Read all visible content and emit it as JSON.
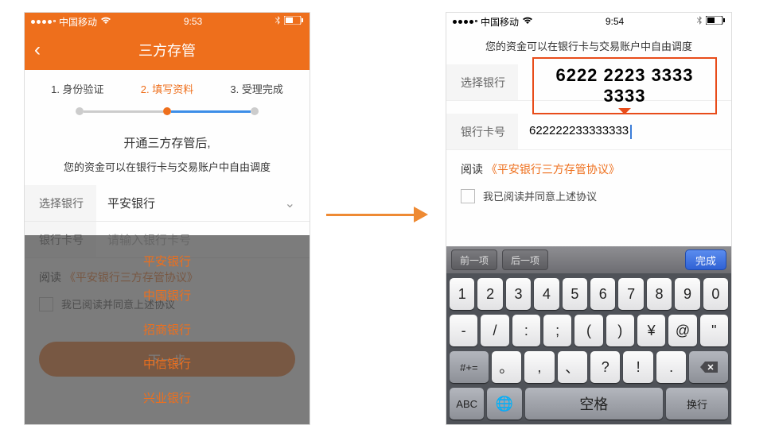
{
  "left": {
    "status": {
      "carrier": "中国移动",
      "time": "9:53"
    },
    "header": {
      "title": "三方存管"
    },
    "steps": {
      "s1": "1. 身份验证",
      "s2": "2. 填写资料",
      "s3": "3. 受理完成"
    },
    "info1": "开通三方存管后,",
    "info2": "您的资金可以在银行卡与交易账户中自由调度",
    "bank": {
      "label": "选择银行",
      "value": "平安银行"
    },
    "card": {
      "label": "银行卡号",
      "placeholder": "请输入银行卡号"
    },
    "readPrefix": "阅读",
    "agreementLink": "《平安银行三方存管协议》",
    "agreeText": "我已阅读并同意上述协议",
    "nextBtn": "下一步",
    "dropdown": [
      "平安银行",
      "中国银行",
      "招商银行",
      "中信银行",
      "兴业银行"
    ]
  },
  "right": {
    "status": {
      "carrier": "中国移动",
      "time": "9:54"
    },
    "info2": "您的资金可以在银行卡与交易账户中自由调度",
    "bank": {
      "label": "选择银行",
      "formatted": "6222 2223 3333 3333"
    },
    "card": {
      "label": "银行卡号",
      "value": "622222233333333"
    },
    "readPrefix": "阅读",
    "agreementLink": "《平安银行三方存管协议》",
    "agreeText": "我已阅读并同意上述协议",
    "kb": {
      "prev": "前一项",
      "next": "后一项",
      "done": "完成",
      "r1": [
        "1",
        "2",
        "3",
        "4",
        "5",
        "6",
        "7",
        "8",
        "9",
        "0"
      ],
      "r2": [
        "-",
        "/",
        ":",
        ";",
        "(",
        ")",
        "¥",
        "@",
        "\""
      ],
      "sym": "#+=",
      "r3": [
        "。",
        ",",
        "、",
        "?",
        "!",
        "."
      ],
      "abc": "ABC",
      "globe": "🌐",
      "space": "空格",
      "return": "换行"
    }
  }
}
